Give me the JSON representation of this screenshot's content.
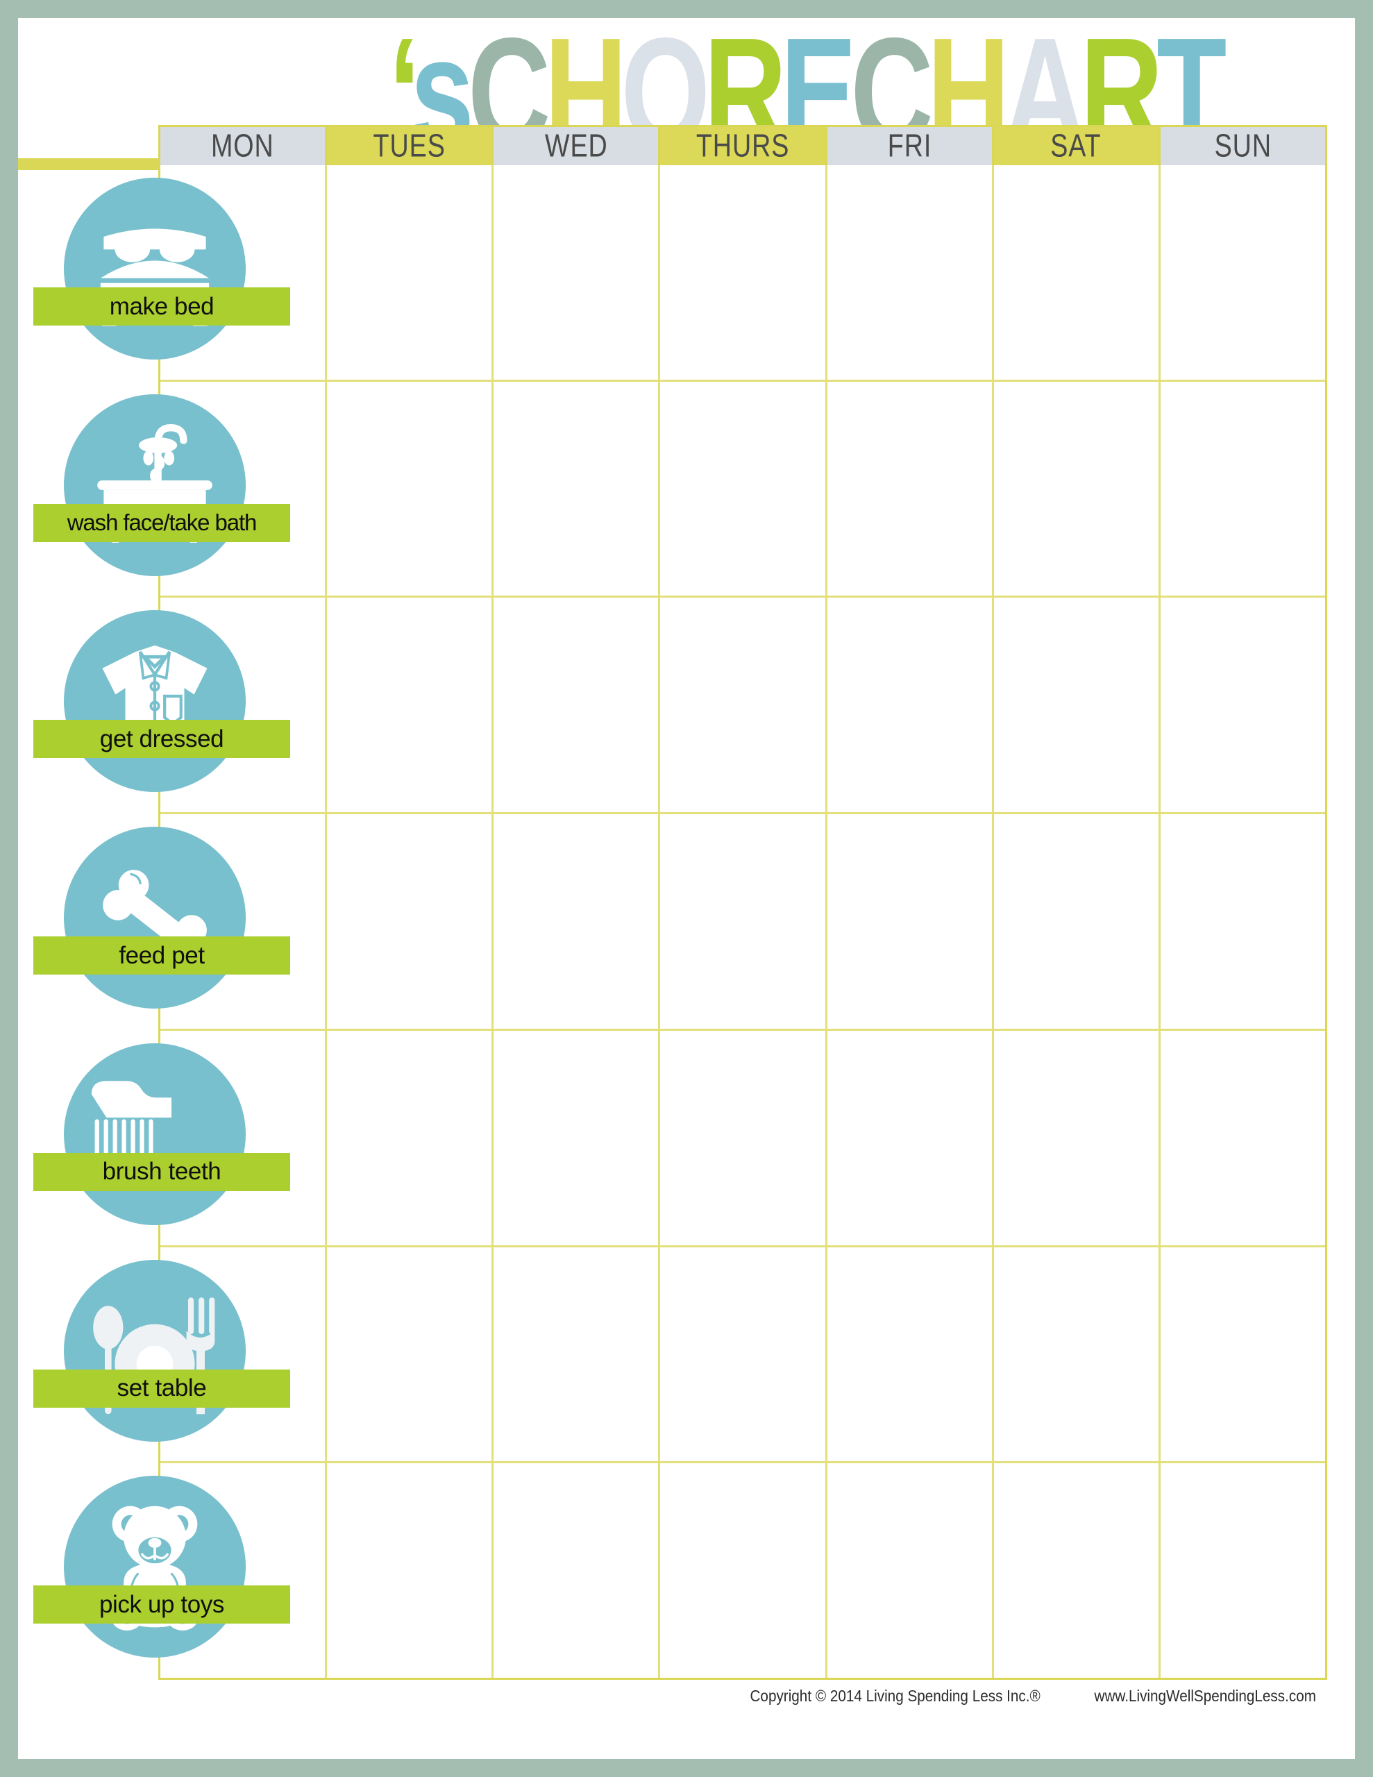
{
  "page": {
    "border_color": "#a4bfb1",
    "background": "#ffffff"
  },
  "header": {
    "name_blank_label": "",
    "title_parts": [
      {
        "text": "‘",
        "color": "#aacf2f"
      },
      {
        "text": "s",
        "color": "#79bfd0"
      },
      {
        "text": "C",
        "color": "#9bb5a8"
      },
      {
        "text": "H",
        "color": "#dcd958"
      },
      {
        "text": "O",
        "color": "#dbe1e8"
      },
      {
        "text": "R",
        "color": "#aacf2f"
      },
      {
        "text": "E",
        "color": "#79bfd0"
      },
      {
        "text": "C",
        "color": "#9bb5a8"
      },
      {
        "text": "H",
        "color": "#dcd958"
      },
      {
        "text": "A",
        "color": "#dbe1e8"
      },
      {
        "text": "R",
        "color": "#aacf2f"
      },
      {
        "text": "T",
        "color": "#79bfd0"
      }
    ],
    "title_text": "'s CHORE CHART"
  },
  "grid": {
    "line_color": "#d9d755",
    "header_gray": "#d7dde3",
    "header_yellow": "#dcd958",
    "days": [
      {
        "label": "MON",
        "style": "gray"
      },
      {
        "label": "TUES",
        "style": "yellow"
      },
      {
        "label": "WED",
        "style": "gray"
      },
      {
        "label": "THURS",
        "style": "yellow"
      },
      {
        "label": "FRI",
        "style": "gray"
      },
      {
        "label": "SAT",
        "style": "yellow"
      },
      {
        "label": "SUN",
        "style": "gray"
      }
    ]
  },
  "chores": [
    {
      "label": "make bed",
      "icon": "bed-icon"
    },
    {
      "label": "wash face/take bath",
      "icon": "bathtub-icon"
    },
    {
      "label": "get dressed",
      "icon": "shirt-icon"
    },
    {
      "label": "feed pet",
      "icon": "bone-icon"
    },
    {
      "label": "brush teeth",
      "icon": "toothbrush-icon"
    },
    {
      "label": "set table",
      "icon": "place-setting-icon"
    },
    {
      "label": "pick up toys",
      "icon": "teddy-bear-icon"
    }
  ],
  "colors": {
    "icon_circle": "#78c0cd",
    "label_green": "#aacf2f",
    "name_line": "#d9d755",
    "text_dark": "#0f0f0f"
  },
  "footer": {
    "copyright": "Copyright © 2014 Living Spending Less Inc.®",
    "website": "www.LivingWellSpendingLess.com"
  }
}
